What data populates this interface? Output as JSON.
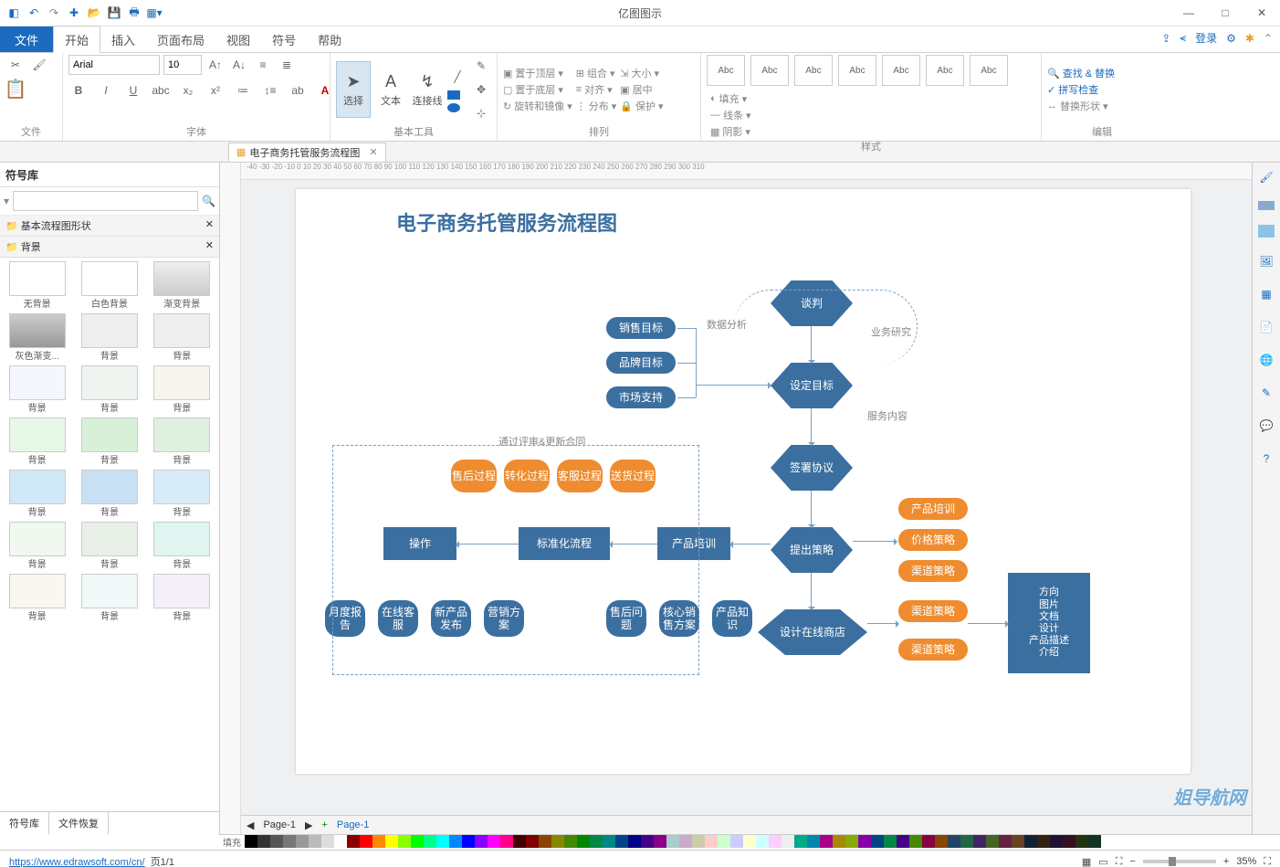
{
  "app_title": "亿图图示",
  "qat": [
    "💾",
    "↶",
    "↷",
    "📂",
    "💾",
    "🖶",
    "📋"
  ],
  "win": {
    "min": "—",
    "max": "□",
    "close": "✕"
  },
  "menu": {
    "file": "文件",
    "tabs": [
      "开始",
      "插入",
      "页面布局",
      "视图",
      "符号",
      "帮助"
    ],
    "active": "开始",
    "right": {
      "login": "登录"
    }
  },
  "ribbon": {
    "file_grp": "文件",
    "font": {
      "name": "Arial",
      "size": "10",
      "group": "字体"
    },
    "tools": {
      "select": "选择",
      "text": "文本",
      "connector": "连接线",
      "group": "基本工具"
    },
    "arrange": {
      "top": "置于顶层",
      "bottom": "置于底层",
      "rotate": "旋转和镜像",
      "combine": "组合",
      "align": "对齐",
      "distribute": "分布",
      "size": "大小",
      "center": "居中",
      "lock": "保护",
      "group": "排列"
    },
    "style": {
      "label": "Abc",
      "group": "样式",
      "fill": "填充",
      "line": "线条",
      "shadow": "阴影"
    },
    "edit": {
      "find": "查找 & 替换",
      "spell": "拼写检查",
      "replace_shape": "替换形状",
      "group": "编辑"
    }
  },
  "doc_tab": "电子商务托管服务流程图",
  "side": {
    "title": "符号库",
    "cat1": "基本流程图形状",
    "cat2": "背景",
    "labels": [
      "无背景",
      "白色背景",
      "渐变背景",
      "灰色渐变...",
      "背景",
      "背景",
      "背景",
      "背景",
      "背景",
      "背景",
      "背景",
      "背景",
      "背景",
      "背景",
      "背景",
      "背景",
      "背景",
      "背景",
      "背景",
      "背景",
      "背景"
    ],
    "foot1": "符号库",
    "foot2": "文件恢复"
  },
  "ruler_marks": "-40  -30  -20  -10   0   10  20  30  40  50  60  70  80  90  100 110 120 130 140 150 160 170 180 190 200 210 220 230 240 250 260 270 280 290 300 310",
  "diagram": {
    "title": "电子商务托管服务流程图",
    "hex": {
      "h1": "谈判",
      "h2": "设定目标",
      "h3": "签署协议",
      "h4": "提出策略",
      "h5": "设计在线商店"
    },
    "rect": {
      "r1": "操作",
      "r2": "标准化流程",
      "r3": "产品培训",
      "r4": "方向\n图片\n文档\n设计\n产品描述\n介绍"
    },
    "pill_b": {
      "p1": "销售目标",
      "p2": "品牌目标",
      "p3": "市场支持",
      "p4": "月度报告",
      "p5": "在线客服",
      "p6": "新产品发布",
      "p7": "营销方案",
      "p8": "售后问题",
      "p9": "核心销售方案",
      "p10": "产品知识"
    },
    "pill_o": {
      "o1": "售后过程",
      "o2": "转化过程",
      "o3": "客服过程",
      "o4": "送货过程",
      "o5": "产品培训",
      "o6": "价格策略",
      "o7": "渠道策略",
      "o8": "渠道策略",
      "o9": "渠道策略"
    },
    "labels": {
      "l1": "数据分析",
      "l2": "业务研究",
      "l3": "服务内容",
      "l4": "通过评审&更新合同"
    }
  },
  "page_bar": {
    "page_name": "Page-1",
    "page_label": "Page-1"
  },
  "status": {
    "url": "https://www.edrawsoft.com/cn/",
    "pages": "页1/1",
    "fill": "填充",
    "zoom": "35%"
  },
  "watermark": "姐导航网",
  "colors": [
    "#000",
    "#333",
    "#555",
    "#777",
    "#999",
    "#bbb",
    "#ddd",
    "#fff",
    "#800",
    "#f00",
    "#f80",
    "#ff0",
    "#8f0",
    "#0f0",
    "#0f8",
    "#0ff",
    "#08f",
    "#00f",
    "#80f",
    "#f0f",
    "#f08",
    "#400",
    "#800000",
    "#884400",
    "#888800",
    "#448800",
    "#008800",
    "#008844",
    "#008888",
    "#004488",
    "#000088",
    "#440088",
    "#880088",
    "#acc",
    "#cac",
    "#cca",
    "#fcc",
    "#cfc",
    "#ccf",
    "#ffc",
    "#cff",
    "#fcf",
    "#eee",
    "#0a8",
    "#08a",
    "#a08",
    "#a80",
    "#8a0",
    "#80a",
    "#048",
    "#084",
    "#408",
    "#480",
    "#804",
    "#840",
    "#246",
    "#264",
    "#426",
    "#462",
    "#624",
    "#642",
    "#123",
    "#321",
    "#213",
    "#312",
    "#231",
    "#132"
  ]
}
